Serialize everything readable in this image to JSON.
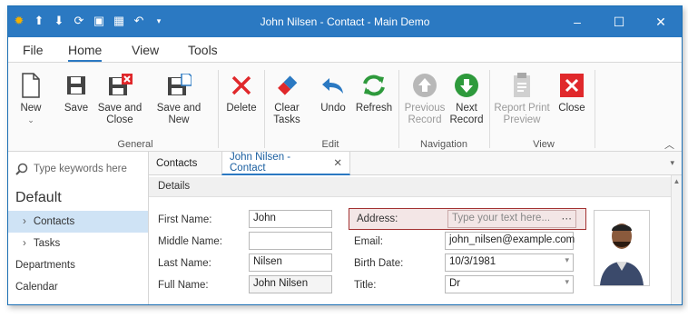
{
  "window": {
    "title": "John Nilsen - Contact - Main Demo"
  },
  "quick_access": {
    "icons": [
      "app-icon",
      "up-arrow-icon",
      "down-arrow-icon",
      "refresh-icon",
      "save-icon",
      "save-close-icon",
      "undo-icon",
      "dropdown-icon"
    ]
  },
  "ribbon_tabs": [
    "File",
    "Home",
    "View",
    "Tools"
  ],
  "ribbon": {
    "new": "New",
    "save": "Save",
    "save_close": "Save and Close",
    "save_new": "Save and New",
    "delete": "Delete",
    "clear_tasks": "Clear Tasks",
    "undo": "Undo",
    "refresh": "Refresh",
    "previous_record": "Previous Record",
    "next_record": "Next Record",
    "report_print_preview": "Report Print Preview",
    "close": "Close",
    "groups": {
      "general": "General",
      "edit": "Edit",
      "navigation": "Navigation",
      "view": "View"
    }
  },
  "sidebar": {
    "search_placeholder": "Type keywords here",
    "group": "Default",
    "items": [
      "Contacts",
      "Tasks",
      "Departments",
      "Calendar"
    ]
  },
  "doc_tabs": {
    "contacts": "Contacts",
    "active": "John Nilsen - Contact"
  },
  "details": {
    "header": "Details",
    "first_name_label": "First Name:",
    "first_name": "John",
    "middle_name_label": "Middle Name:",
    "middle_name": "",
    "last_name_label": "Last Name:",
    "last_name": "Nilsen",
    "full_name_label": "Full Name:",
    "full_name": "John Nilsen",
    "address_label": "Address:",
    "address_placeholder": "Type your text here...",
    "email_label": "Email:",
    "email": "john_nilsen@example.com",
    "birth_date_label": "Birth Date:",
    "birth_date": "10/3/1981",
    "title_label": "Title:",
    "title": "Dr"
  },
  "colors": {
    "accent": "#2b79c2",
    "delete_red": "#e0282b",
    "green": "#2e9a3c",
    "address_border": "#a33232"
  }
}
